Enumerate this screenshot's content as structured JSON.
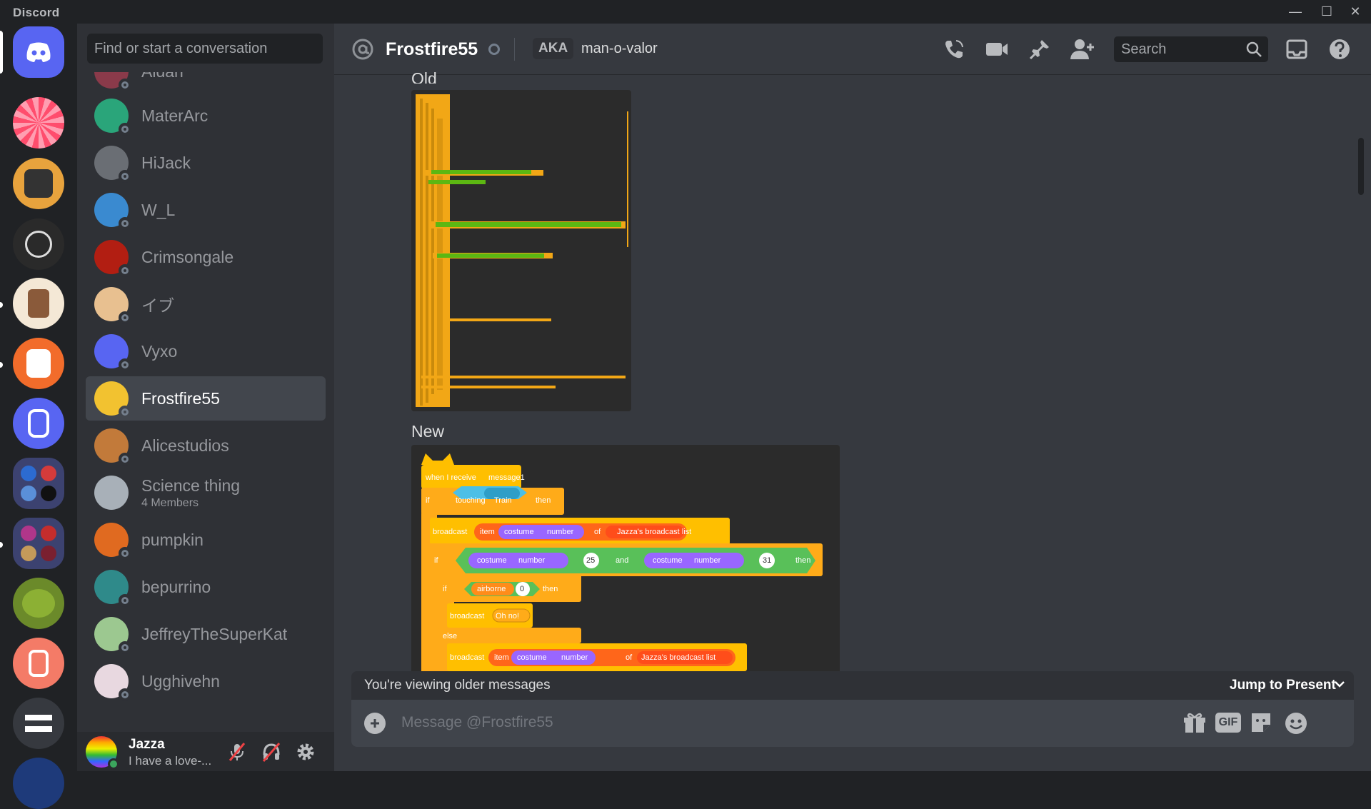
{
  "app": {
    "name": "Discord"
  },
  "colors": {
    "blurple": "#5865f2",
    "rail": "#202225",
    "sidebar": "#2f3136",
    "chat": "#36393f",
    "online": "#3ba55d",
    "offline": "#747f8d"
  },
  "dm_search": {
    "placeholder": "Find or start a conversation"
  },
  "dms": [
    {
      "name": "Aidan",
      "sub": ""
    },
    {
      "name": "MaterArc",
      "sub": ""
    },
    {
      "name": "HiJack",
      "sub": ""
    },
    {
      "name": "W_L",
      "sub": ""
    },
    {
      "name": "Crimsongale",
      "sub": ""
    },
    {
      "name": "イブ",
      "sub": ""
    },
    {
      "name": "Vyxo",
      "sub": ""
    },
    {
      "name": "Frostfire55",
      "sub": "",
      "active": true
    },
    {
      "name": "Alicestudios",
      "sub": ""
    },
    {
      "name": "Science thing",
      "sub": "4 Members"
    },
    {
      "name": "pumpkin",
      "sub": ""
    },
    {
      "name": "bepurrino",
      "sub": ""
    },
    {
      "name": "JeffreyTheSuperKat",
      "sub": ""
    },
    {
      "name": "Ugghivehn",
      "sub": ""
    }
  ],
  "user": {
    "name": "Jazza",
    "status": "I have a love-..."
  },
  "header": {
    "name": "Frostfire55",
    "aka_label": "AKA",
    "aka_value": "man-o-valor",
    "search_placeholder": "Search"
  },
  "messages": {
    "old_label": "Old",
    "new_label": "New"
  },
  "scratch": {
    "hat": "when I receive",
    "msg1": "message1",
    "if": "if",
    "touching": "touching",
    "train": "Train",
    "q": "?",
    "then": "then",
    "broadcast": "broadcast",
    "item": "item",
    "costume": "costume",
    "number": "number",
    "of": "of",
    "list": "Jazza's broadcast list",
    "gt_val": "25",
    "and": "and",
    "lt_val": "31",
    "airborne": "airborne",
    "eq": "=",
    "zero": "0",
    "ohno": "Oh no!",
    "else": "else"
  },
  "banner": {
    "older": "You're viewing older messages",
    "jump": "Jump to Present"
  },
  "composer": {
    "placeholder": "Message @Frostfire55",
    "gif": "GIF"
  }
}
